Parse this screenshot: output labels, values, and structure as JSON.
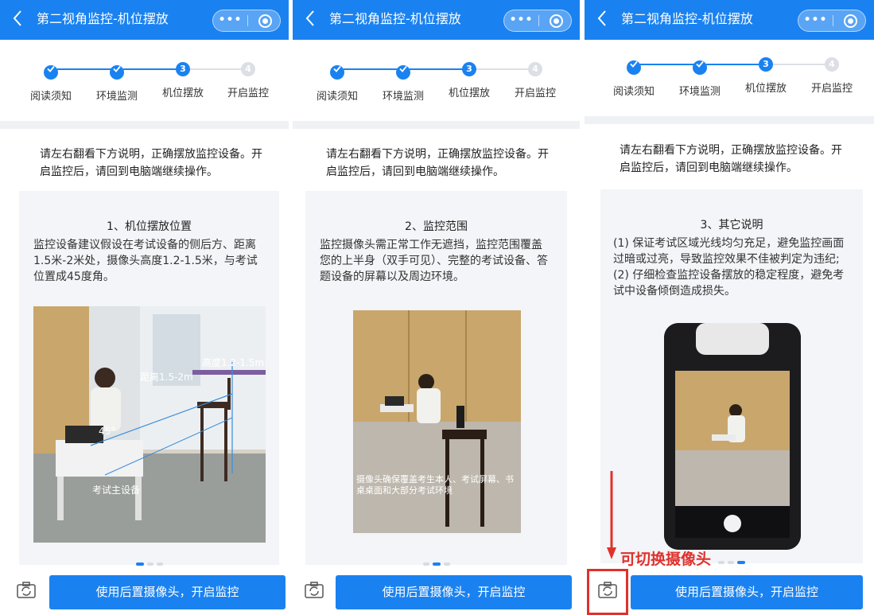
{
  "nav": {
    "title": "第二视角监控-机位摆放",
    "more_glyph": "•••"
  },
  "steps": [
    {
      "label": "阅读须知",
      "status": "done",
      "number": "1"
    },
    {
      "label": "环境监测",
      "status": "done",
      "number": "2"
    },
    {
      "label": "机位摆放",
      "status": "current",
      "number": "3"
    },
    {
      "label": "开启监控",
      "status": "todo",
      "number": "4"
    }
  ],
  "intro": "请左右翻看下方说明，正确摆放监控设备。开启监控后，请回到电脑端继续操作。",
  "panels": [
    {
      "heading": "1、机位摆放位置",
      "body": "监控设备建议假设在考试设备的侧后方、距离1.5米-2米处，摄像头高度1.2-1.5米，与考试位置成45度角。",
      "photo_labels": [
        "高度1.2-1.5m",
        "距离1.5-2m",
        "45°",
        "考试主设备"
      ],
      "active_page": 0
    },
    {
      "heading": "2、监控范围",
      "body": "监控摄像头需正常工作无遮挡，监控范围覆盖您的上半身（双手可见）、完整的考试设备、答题设备的屏幕以及周边环境。",
      "photo_labels": [
        "摄像头确保覆盖考生本人、考试屏幕、书桌桌面和大部分考试环境"
      ],
      "active_page": 1
    },
    {
      "heading": "3、其它说明",
      "body": "(1) 保证考试区域光线均匀充足，避免监控画面过暗或过亮，导致监控效果不佳被判定为违纪;(2) 仔细检查监控设备摆放的稳定程度，避免考试中设备倾倒造成损失。",
      "photo_labels": [],
      "active_page": 2
    }
  ],
  "pager_count": 3,
  "bottom": {
    "start_button": "使用后置摄像头，开启监控"
  },
  "annotation": {
    "text": "可切换摄像头",
    "color": "#e0312b"
  },
  "colors": {
    "primary": "#1a82f0",
    "inactive": "#dcdfe4",
    "card_bg": "#f3f5f8",
    "divider": "#eff1f4"
  }
}
